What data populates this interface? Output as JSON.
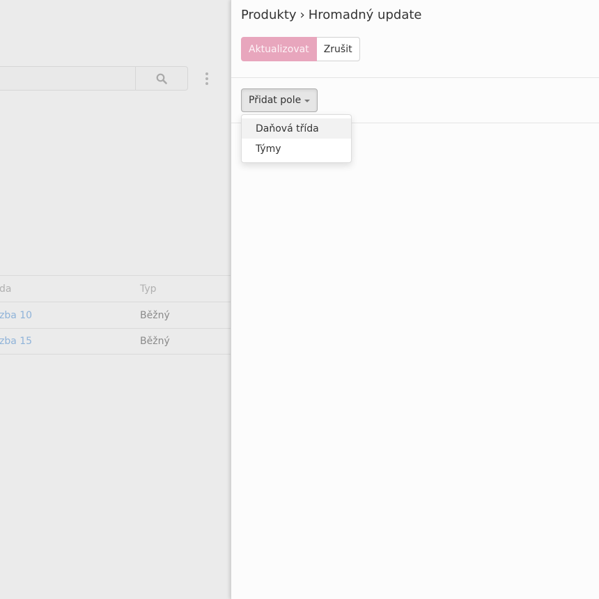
{
  "background": {
    "table": {
      "headers": [
        "da",
        "Typ"
      ],
      "rows": [
        {
          "name": "zba 10",
          "type": "Běžný"
        },
        {
          "name": "zba 15",
          "type": "Běžný"
        }
      ]
    },
    "search_icon": "search-icon",
    "menu_icon": "kebab-menu-icon"
  },
  "panel": {
    "breadcrumb": {
      "parent": "Produkty",
      "separator": "›",
      "current": "Hromadný update"
    },
    "actions": {
      "update_label": "Aktualizovat",
      "cancel_label": "Zrušit"
    },
    "add_field": {
      "label": "Přidat pole",
      "options": [
        "Daňová třída",
        "Týmy"
      ]
    }
  },
  "colors": {
    "primary": "#e8a6bd",
    "link": "#8fb3d9"
  }
}
